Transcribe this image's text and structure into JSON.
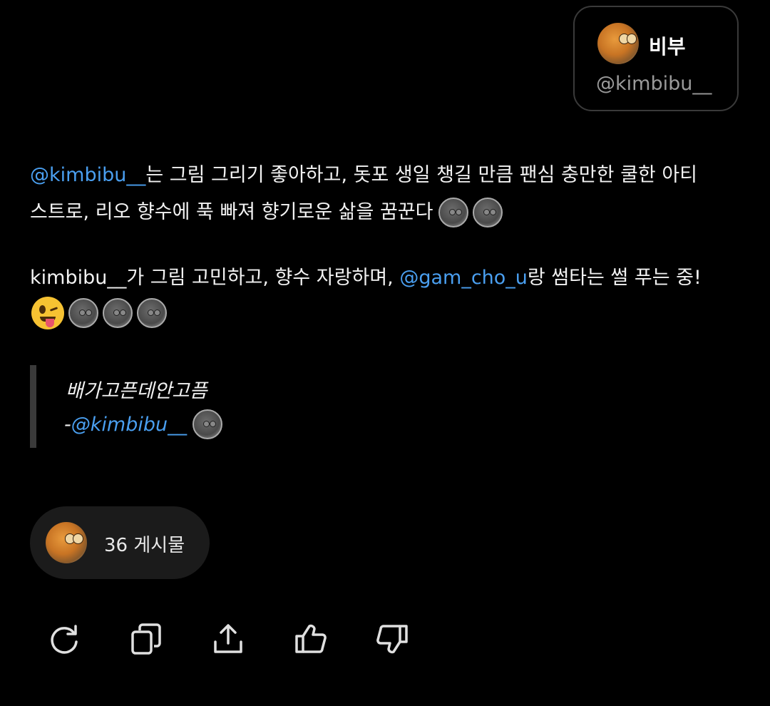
{
  "profile": {
    "name": "비부",
    "handle": "@kimbibu__"
  },
  "post": {
    "p1_mention": "@kimbibu__",
    "p1_line1_rest": "는 그림 그리기 좋아하고, 돗포 생일 챙길 만큼 팬심 충만한 쿨한 아티",
    "p1_line2": "스트로, 리오 향수에 푹 빠져 향기로운 삶을 꿈꾼다",
    "p2_start": "kimbibu__가 그림 고민하고, 향수 자랑하며, ",
    "p2_mention": "@gam_cho_u",
    "p2_end": "랑 썸타는 썰 푸는 중!",
    "quote_text": "배가고픈데안고픔",
    "quote_dash": "-",
    "quote_mention": "@kimbibu__"
  },
  "posts_count": {
    "label": "36 게시물"
  },
  "actions": {
    "icons": [
      "refresh-icon",
      "copy-icon",
      "share-icon",
      "thumbs-up-icon",
      "thumbs-down-icon"
    ]
  },
  "colors": {
    "background": "#000000",
    "mention": "#4a9ff0",
    "text": "#f2f2f2",
    "muted": "#9a9a9a"
  }
}
